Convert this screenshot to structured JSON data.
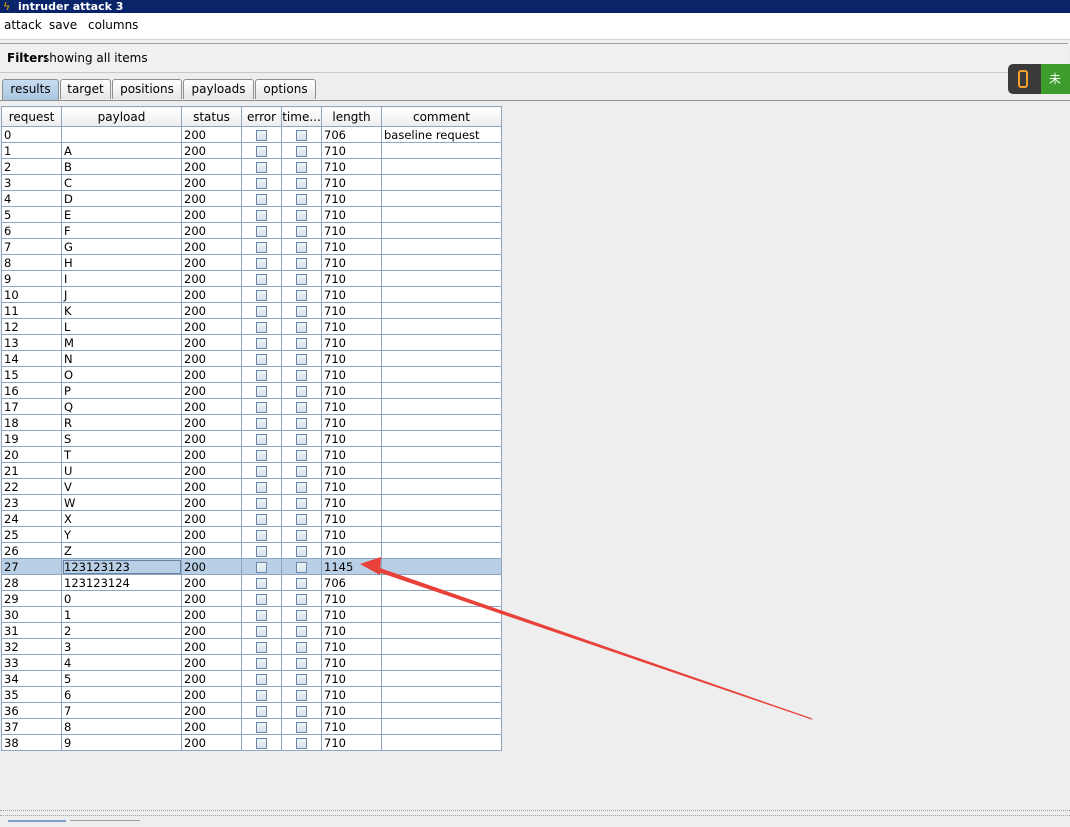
{
  "window": {
    "title": "intruder attack 3"
  },
  "menu": [
    "attack",
    "save",
    "columns"
  ],
  "filter": {
    "label": "Filter:",
    "value": "showing all items"
  },
  "tabs": [
    "results",
    "target",
    "positions",
    "payloads",
    "options"
  ],
  "active_tab": "results",
  "table": {
    "columns": [
      "request",
      "payload",
      "status",
      "error",
      "time...",
      "length",
      "comment"
    ],
    "selected_row": 27,
    "rows": [
      {
        "request": "0",
        "payload": "",
        "status": "200",
        "length": "706",
        "comment": "baseline request"
      },
      {
        "request": "1",
        "payload": "A",
        "status": "200",
        "length": "710",
        "comment": ""
      },
      {
        "request": "2",
        "payload": "B",
        "status": "200",
        "length": "710",
        "comment": ""
      },
      {
        "request": "3",
        "payload": "C",
        "status": "200",
        "length": "710",
        "comment": ""
      },
      {
        "request": "4",
        "payload": "D",
        "status": "200",
        "length": "710",
        "comment": ""
      },
      {
        "request": "5",
        "payload": "E",
        "status": "200",
        "length": "710",
        "comment": ""
      },
      {
        "request": "6",
        "payload": "F",
        "status": "200",
        "length": "710",
        "comment": ""
      },
      {
        "request": "7",
        "payload": "G",
        "status": "200",
        "length": "710",
        "comment": ""
      },
      {
        "request": "8",
        "payload": "H",
        "status": "200",
        "length": "710",
        "comment": ""
      },
      {
        "request": "9",
        "payload": "I",
        "status": "200",
        "length": "710",
        "comment": ""
      },
      {
        "request": "10",
        "payload": "J",
        "status": "200",
        "length": "710",
        "comment": ""
      },
      {
        "request": "11",
        "payload": "K",
        "status": "200",
        "length": "710",
        "comment": ""
      },
      {
        "request": "12",
        "payload": "L",
        "status": "200",
        "length": "710",
        "comment": ""
      },
      {
        "request": "13",
        "payload": "M",
        "status": "200",
        "length": "710",
        "comment": ""
      },
      {
        "request": "14",
        "payload": "N",
        "status": "200",
        "length": "710",
        "comment": ""
      },
      {
        "request": "15",
        "payload": "O",
        "status": "200",
        "length": "710",
        "comment": ""
      },
      {
        "request": "16",
        "payload": "P",
        "status": "200",
        "length": "710",
        "comment": ""
      },
      {
        "request": "17",
        "payload": "Q",
        "status": "200",
        "length": "710",
        "comment": ""
      },
      {
        "request": "18",
        "payload": "R",
        "status": "200",
        "length": "710",
        "comment": ""
      },
      {
        "request": "19",
        "payload": "S",
        "status": "200",
        "length": "710",
        "comment": ""
      },
      {
        "request": "20",
        "payload": "T",
        "status": "200",
        "length": "710",
        "comment": ""
      },
      {
        "request": "21",
        "payload": "U",
        "status": "200",
        "length": "710",
        "comment": ""
      },
      {
        "request": "22",
        "payload": "V",
        "status": "200",
        "length": "710",
        "comment": ""
      },
      {
        "request": "23",
        "payload": "W",
        "status": "200",
        "length": "710",
        "comment": ""
      },
      {
        "request": "24",
        "payload": "X",
        "status": "200",
        "length": "710",
        "comment": ""
      },
      {
        "request": "25",
        "payload": "Y",
        "status": "200",
        "length": "710",
        "comment": ""
      },
      {
        "request": "26",
        "payload": "Z",
        "status": "200",
        "length": "710",
        "comment": ""
      },
      {
        "request": "27",
        "payload": "123123123",
        "status": "200",
        "length": "1145",
        "comment": ""
      },
      {
        "request": "28",
        "payload": "123123124",
        "status": "200",
        "length": "706",
        "comment": ""
      },
      {
        "request": "29",
        "payload": "0",
        "status": "200",
        "length": "710",
        "comment": ""
      },
      {
        "request": "30",
        "payload": "1",
        "status": "200",
        "length": "710",
        "comment": ""
      },
      {
        "request": "31",
        "payload": "2",
        "status": "200",
        "length": "710",
        "comment": ""
      },
      {
        "request": "32",
        "payload": "3",
        "status": "200",
        "length": "710",
        "comment": ""
      },
      {
        "request": "33",
        "payload": "4",
        "status": "200",
        "length": "710",
        "comment": ""
      },
      {
        "request": "34",
        "payload": "5",
        "status": "200",
        "length": "710",
        "comment": ""
      },
      {
        "request": "35",
        "payload": "6",
        "status": "200",
        "length": "710",
        "comment": ""
      },
      {
        "request": "36",
        "payload": "7",
        "status": "200",
        "length": "710",
        "comment": ""
      },
      {
        "request": "37",
        "payload": "8",
        "status": "200",
        "length": "710",
        "comment": ""
      },
      {
        "request": "38",
        "payload": "9",
        "status": "200",
        "length": "710",
        "comment": ""
      }
    ]
  },
  "side_widget": {
    "text": "未"
  },
  "annotation": {
    "color": "#e8413a",
    "points_to": "1145"
  },
  "icons": {
    "app": "burp-lightning-icon",
    "widget": "plug-icon"
  }
}
